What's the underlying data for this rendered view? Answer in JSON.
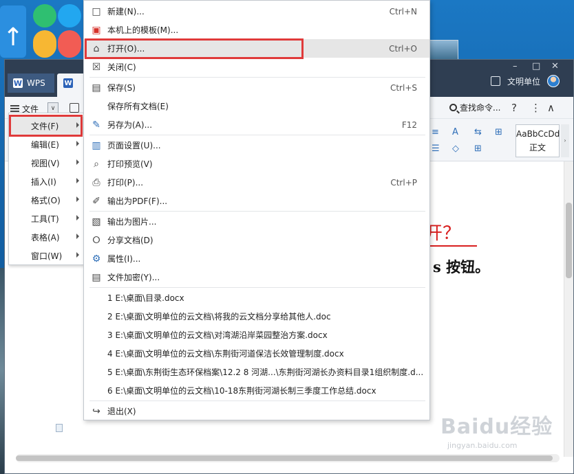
{
  "wps": {
    "tab_label": "WPS",
    "user_name": "文明单位",
    "menu_label": "文件",
    "search_label": "查找命令...",
    "style_sample": "AaBbCcDd",
    "style_name": "正文"
  },
  "document": {
    "heading_tail": "开？",
    "body_tail": "s 按钮。"
  },
  "left_menu": [
    {
      "label": "文件(F)"
    },
    {
      "label": "编辑(E)"
    },
    {
      "label": "视图(V)"
    },
    {
      "label": "插入(I)"
    },
    {
      "label": "格式(O)"
    },
    {
      "label": "工具(T)"
    },
    {
      "label": "表格(A)"
    },
    {
      "label": "窗口(W)"
    }
  ],
  "file_menu": {
    "new": {
      "label": "新建(N)...",
      "shortcut": "Ctrl+N"
    },
    "templates": {
      "label": "本机上的模板(M)..."
    },
    "open": {
      "label": "打开(O)...",
      "shortcut": "Ctrl+O"
    },
    "close": {
      "label": "关闭(C)"
    },
    "save": {
      "label": "保存(S)",
      "shortcut": "Ctrl+S"
    },
    "save_all": {
      "label": "保存所有文档(E)"
    },
    "save_as": {
      "label": "另存为(A)...",
      "shortcut": "F12"
    },
    "page_setup": {
      "label": "页面设置(U)..."
    },
    "print_preview": {
      "label": "打印预览(V)"
    },
    "print": {
      "label": "打印(P)...",
      "shortcut": "Ctrl+P"
    },
    "export_pdf": {
      "label": "输出为PDF(F)..."
    },
    "export_image": {
      "label": "输出为图片..."
    },
    "share": {
      "label": "分享文档(D)"
    },
    "properties": {
      "label": "属性(I)..."
    },
    "encrypt": {
      "label": "文件加密(Y)..."
    },
    "recent": [
      "1 E:\\桌面\\目录.docx",
      "2 E:\\桌面\\文明单位的云文档\\将我的云文档分享给其他人.doc",
      "3 E:\\桌面\\文明单位的云文档\\对湾湖沿岸菜园整治方案.docx",
      "4 E:\\桌面\\文明单位的云文档\\东荆街河道保洁长效管理制度.docx",
      "5 E:\\桌面\\东荆街生态环保档案\\12.2 8 河湖...\\东荆街河湖长办资料目录1组织制度.d...",
      "6 E:\\桌面\\文明单位的云文档\\10-18东荆街河湖长制三季度工作总结.docx"
    ],
    "exit": {
      "label": "退出(X)"
    }
  },
  "watermark": {
    "brand": "Baidu经验",
    "url": "jingyan.baidu.com"
  },
  "colors": {
    "highlight_border": "#e03a3a",
    "titlebar": "#2f3e52",
    "heading_red": "#d81e1e"
  }
}
